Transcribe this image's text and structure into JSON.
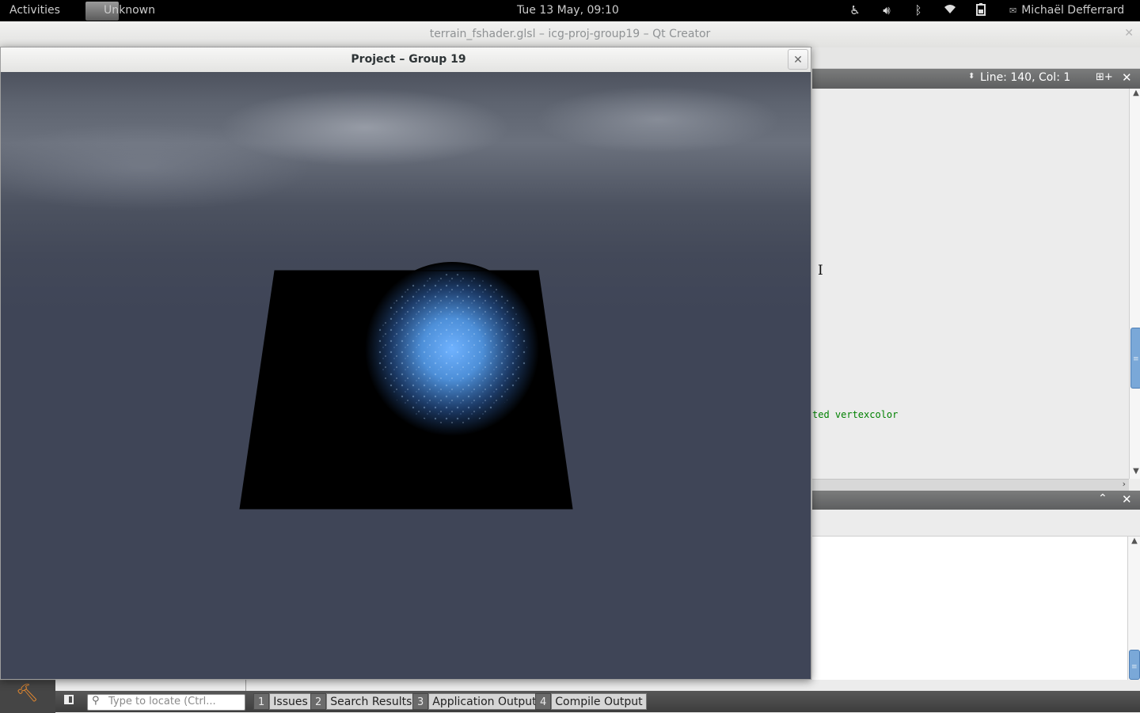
{
  "topbar": {
    "activities": "Activities",
    "app_name": "Unknown",
    "clock": "Tue 13 May, 09:10",
    "user_name": "Michaël Defferrard",
    "tray_icons": [
      "accessibility-icon",
      "volume-icon",
      "bluetooth-icon",
      "wifi-icon",
      "battery-icon"
    ]
  },
  "qt_window": {
    "title": "terrain_fshader.glsl – icg-proj-group19 – Qt Creator",
    "editor": {
      "position": "Line: 140, Col: 1",
      "visible_code": "ted vertexcolor"
    },
    "locator": {
      "placeholder": "Type to locate (Ctrl..."
    },
    "output_tabs": [
      {
        "num": "1",
        "label": "Issues"
      },
      {
        "num": "2",
        "label": "Search Results"
      },
      {
        "num": "3",
        "label": "Application Output"
      },
      {
        "num": "4",
        "label": "Compile Output"
      }
    ]
  },
  "project_window": {
    "title": "Project – Group 19"
  },
  "colors": {
    "sky_base": "#3f4557",
    "terrain_glow": "#5aa2f0",
    "code_comment": "#008000",
    "scrollbar_thumb": "#7aa8d8"
  }
}
